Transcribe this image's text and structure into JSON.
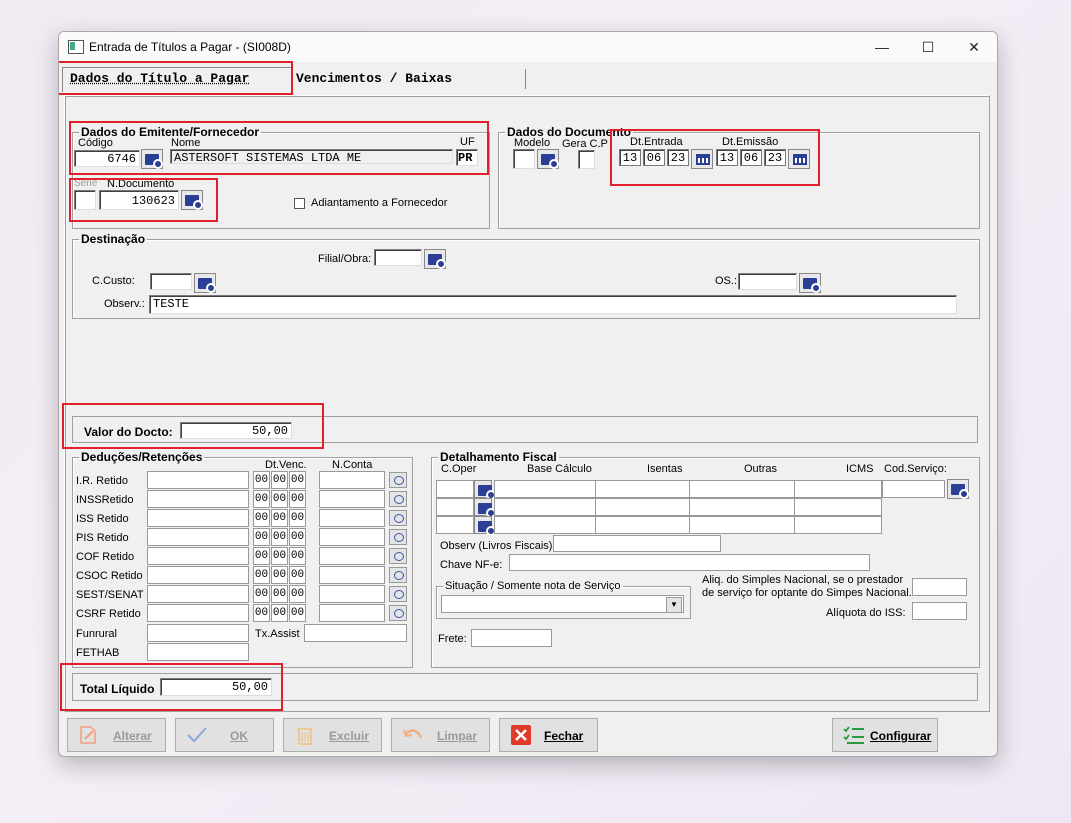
{
  "window": {
    "title": "Entrada de Títulos a Pagar - (SI008D)",
    "minimize": "—",
    "maximize": "☐",
    "close": "✕"
  },
  "tabs": [
    "Dados do Título a Pagar",
    "Vencimentos / Baixas"
  ],
  "emitente": {
    "legend": "Dados do Emitente/Fornecedor",
    "codigo_label": "Código",
    "codigo": "6746",
    "nome_label": "Nome",
    "nome": "ASTERSOFT SISTEMAS LTDA ME",
    "uf_label": "UF",
    "uf": "PR",
    "serie_label": "Serie",
    "serie": "",
    "ndoc_label": "N.Documento",
    "ndoc": "130623",
    "adiantamento_label": "Adiantamento a Fornecedor"
  },
  "documento": {
    "legend": "Dados do Documento",
    "modelo_label": "Modelo",
    "gera_label": "Gera C.P",
    "dt_entrada_label": "Dt.Entrada",
    "dt_entrada": [
      "13",
      "06",
      "23"
    ],
    "dt_emissao_label": "Dt.Emissão",
    "dt_emissao": [
      "13",
      "06",
      "23"
    ]
  },
  "destinacao": {
    "legend": "Destinação",
    "filial_label": "Filial/Obra:",
    "filial": "",
    "ccusto_label": "C.Custo:",
    "ccusto": "",
    "os_label": "OS.:",
    "os": "",
    "observ_label": "Observ.:",
    "observ": "TESTE"
  },
  "valor": {
    "label": "Valor do Docto:",
    "value": "50,00"
  },
  "deducoes": {
    "legend": "Deduções/Retenções",
    "dtvenc_label": "Dt.Venc.",
    "nconta_label": "N.Conta",
    "rows": [
      "I.R. Retido",
      "INSSRetido",
      "ISS Retido",
      "PIS Retido",
      "COF Retido",
      "CSOC Retido",
      "SEST/SENAT",
      "CSRF Retido"
    ],
    "date_seg": "00",
    "funrural": "Funrural",
    "fethab": "FETHAB",
    "txassist": "Tx.Assist"
  },
  "fiscal": {
    "legend": "Detalhamento Fiscal",
    "headers": [
      "C.Oper",
      "Base Cálculo",
      "Isentas",
      "Outras",
      "ICMS",
      "Cod.Serviço:"
    ],
    "observ_label": "Observ (Livros Fiscais):",
    "chave_label": "Chave NF-e:",
    "situacao_legend": "Situação / Somente nota de Serviço",
    "aliq_simples_label1": "Aliq. do Simples Nacional, se o prestador",
    "aliq_simples_label2": "de serviço for optante do Simpes Nacional.",
    "aliq_iss_label": "Alíquota do ISS:",
    "frete_label": "Frete:"
  },
  "total": {
    "label": "Total Líquido",
    "value": "50,00"
  },
  "buttons": {
    "alterar": "Alterar",
    "ok": "OK",
    "excluir": "Excluir",
    "limpar": "Limpar",
    "fechar": "Fechar",
    "configurar": "Configurar"
  }
}
